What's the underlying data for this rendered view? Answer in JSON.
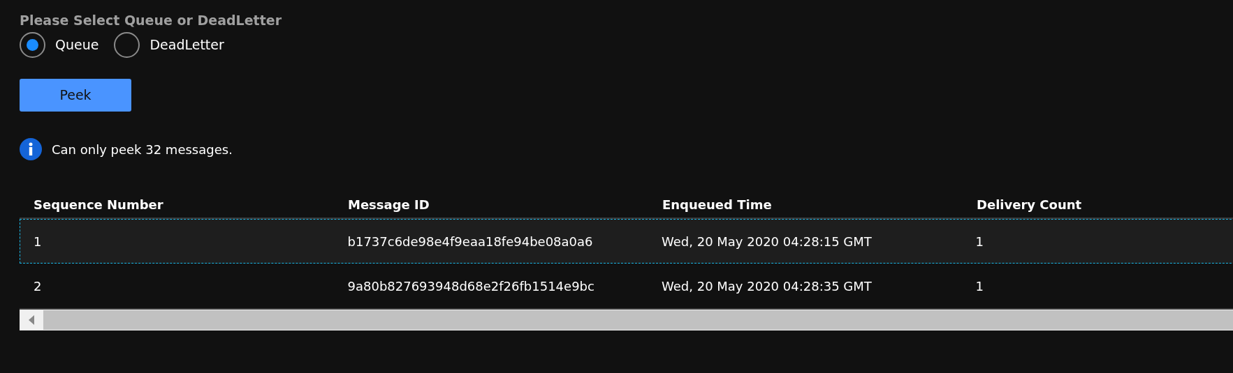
{
  "source_picker": {
    "label": "Please Select Queue or DeadLetter",
    "options": [
      {
        "label": "Queue",
        "selected": true
      },
      {
        "label": "DeadLetter",
        "selected": false
      }
    ]
  },
  "peek_button": {
    "label": "Peek"
  },
  "notice": {
    "text": "Can only peek 32 messages."
  },
  "table": {
    "columns": [
      "Sequence Number",
      "Message ID",
      "Enqueued Time",
      "Delivery Count"
    ],
    "rows": [
      {
        "selected": true,
        "cells": [
          "1",
          "b1737c6de98e4f9eaa18fe94be08a0a6",
          "Wed, 20 May 2020 04:28:15 GMT",
          "1"
        ]
      },
      {
        "selected": false,
        "cells": [
          "2",
          "9a80b827693948d68e2f26fb1514e9bc",
          "Wed, 20 May 2020 04:28:35 GMT",
          "1"
        ]
      }
    ]
  }
}
